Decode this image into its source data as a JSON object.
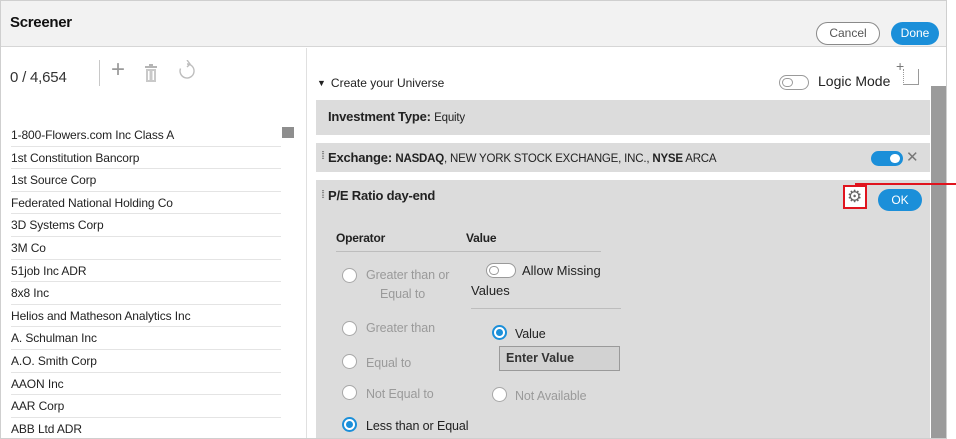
{
  "header": {
    "title": "Screener",
    "cancel_label": "Cancel",
    "done_label": "Done"
  },
  "left": {
    "count": "0 / 4,654",
    "icons": {
      "add": "plus-icon",
      "delete": "trash-icon",
      "refresh": "refresh-icon"
    },
    "companies": [
      "1-800-Flowers.com Inc Class A",
      "1st Constitution Bancorp",
      "1st Source Corp",
      "Federated National Holding Co",
      "3D Systems Corp",
      "3M Co",
      "51job Inc ADR",
      "8x8 Inc",
      "Helios and Matheson Analytics Inc",
      "A. Schulman Inc",
      "A.O. Smith Corp",
      "AAON Inc",
      "AAR Corp",
      "ABB Ltd ADR"
    ]
  },
  "right": {
    "universe_label": "Create your Universe",
    "logic_mode_label": "Logic Mode",
    "investment_type": {
      "label": "Investment Type:",
      "value": "Equity"
    },
    "exchange": {
      "label": "Exchange:",
      "value_bold": "NASDAQ",
      "value_middle": ", NEW YORK STOCK EXCHANGE, INC., ",
      "value_bold2": "NYSE",
      "value_tail": " ARCA"
    },
    "pe": {
      "title": "P/E Ratio day-end",
      "ok_label": "OK",
      "operator_header": "Operator",
      "value_header": "Value",
      "operators": [
        "Greater than or",
        "Equal to",
        "Greater than",
        "Equal to",
        "Not Equal to",
        "Less than or Equal"
      ],
      "allow_missing_1": "Allow Missing",
      "allow_missing_2": "Values",
      "value_option": "Value",
      "value_placeholder": "Enter Value",
      "not_available": "Not Available"
    }
  },
  "colors": {
    "accent": "#1b8fd9",
    "highlight": "#e0141e",
    "row_bg": "#dcdcdc"
  }
}
